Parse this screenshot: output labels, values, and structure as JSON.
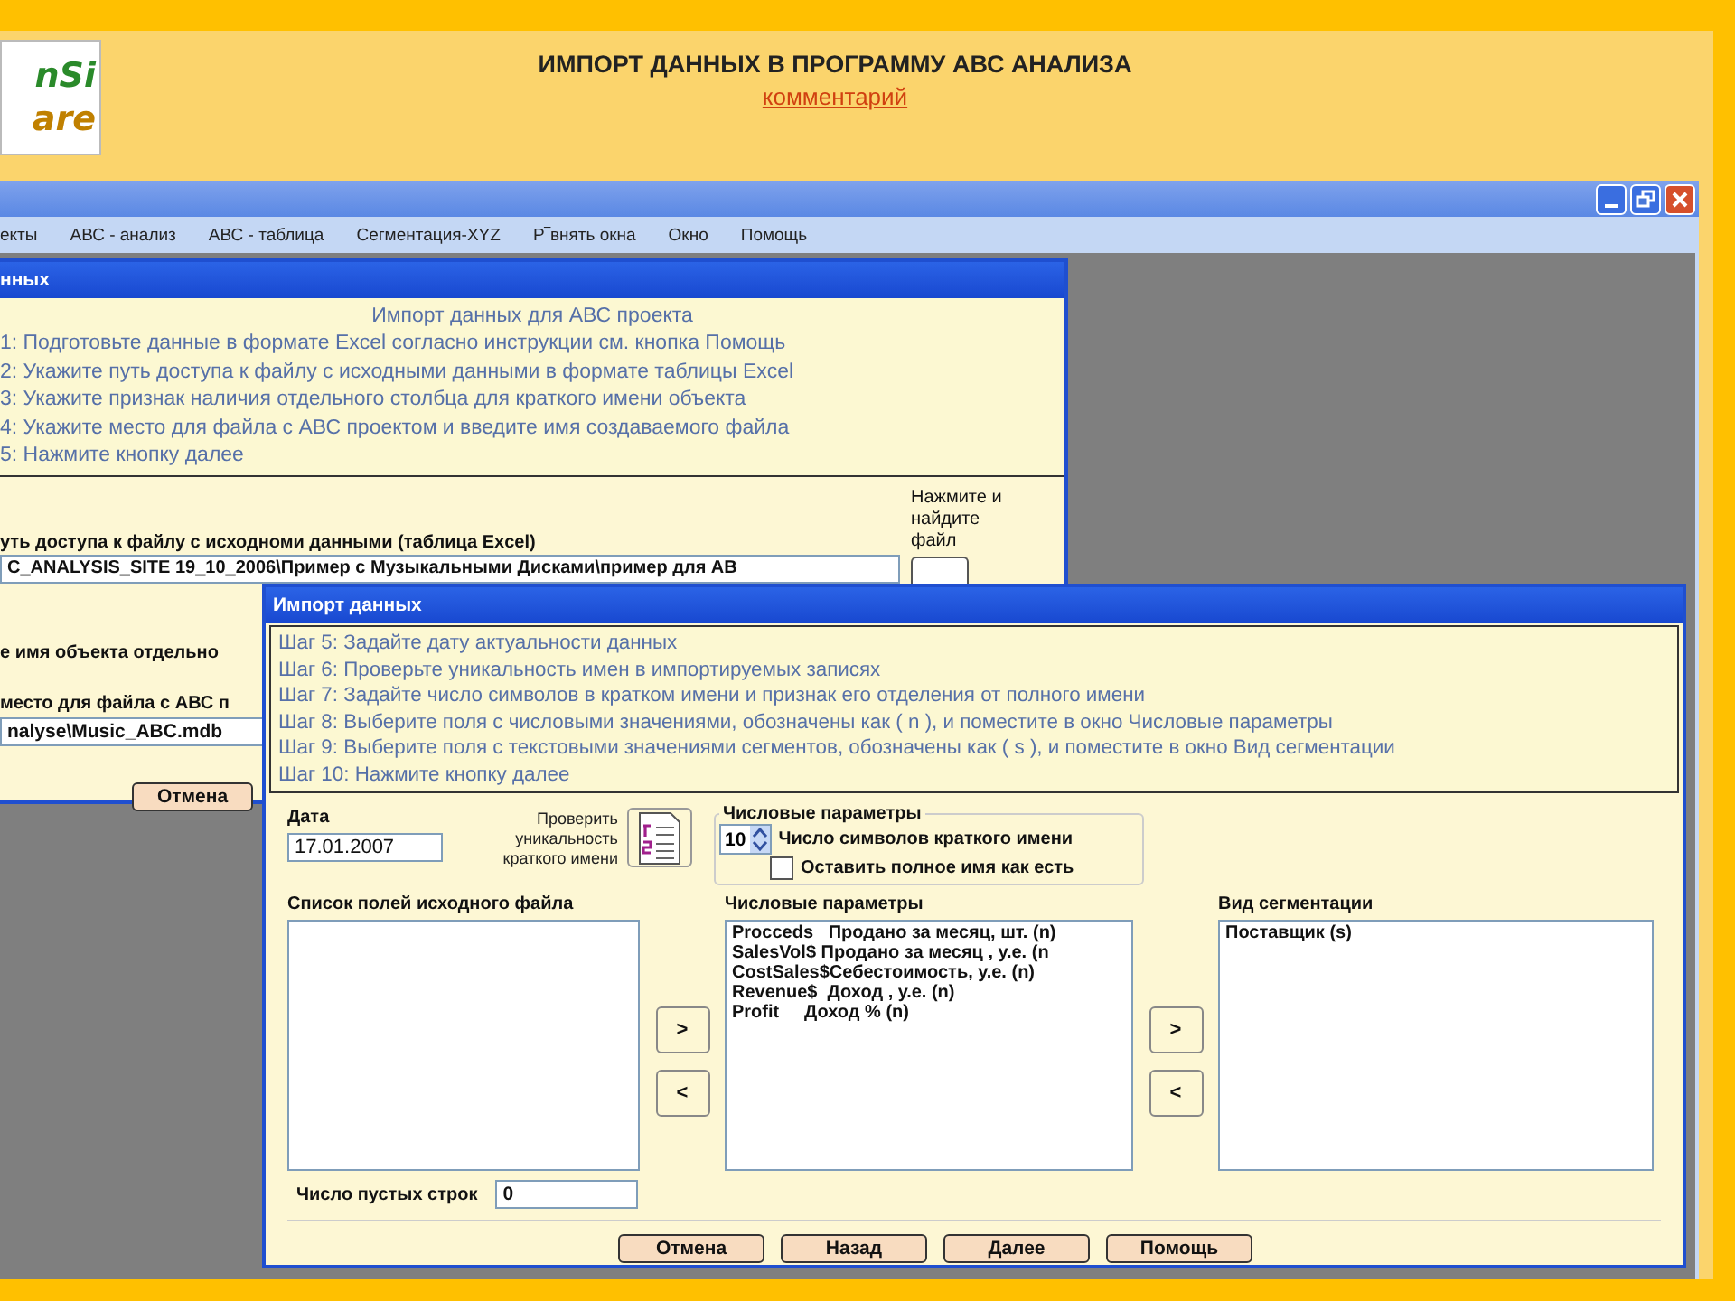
{
  "page": {
    "logo": [
      "nSi",
      "are"
    ],
    "heading": "ИМПОРТ ДАННЫХ В ПРОГРАММУ АВС АНАЛИЗА",
    "link": "комментарий"
  },
  "app_window": {
    "menu": [
      "екты",
      "АВС - анализ",
      "АВС - таблица",
      "Сегментация-XYZ",
      "Р‾внять окна",
      "Окно",
      "Помощь"
    ]
  },
  "dialog_back": {
    "title": "нных",
    "intro_title": "Импорт данных для АВС проекта",
    "steps": [
      "1: Подготовьте данные в формате Excel согласно инструкции см. кнопка Помощь",
      "2: Укажите путь доступа к файлу с исходными данными в формате таблицы Excel",
      "3: Укажите признак наличия отдельного столбца для краткого имени объекта",
      "4: Укажите место для файла с АВС проектом и введите имя создаваемого файла",
      "5: Нажмите кнопку далее"
    ],
    "browse_hint": "Нажмите и найдите файл",
    "path_label": "уть доступа к файлу с исходноми данными (таблица Excel)",
    "path_value": "C_ANALYSIS_SITE 19_10_2006\\Пример с Музыкальными Дисками\\пример для АВ",
    "short_name_label": "е имя объекта отдельно",
    "project_label": "место для файла с АВС п",
    "project_value": "nalyse\\Music_ABC.mdb",
    "cancel": "Отмена"
  },
  "dialog_front": {
    "title": "Импорт данных",
    "steps": [
      "Шаг 5: Задайте дату актуальности данных",
      "Шаг 6: Проверьте уникальность имен в импортируемых записях",
      "Шаг 7: Задайте число символов в кратком имени и признак его отделения от полного имени",
      "Шаг 8: Выберите поля с  числовыми значениями, обозначены как ( n ), и поместите в окно Числовые параметры",
      "Шаг 9: Выберите поля с  текстовыми значениями сегментов, обозначены как ( s ), и поместите в окно Вид сегментации",
      "Шаг 10: Нажмите кнопку далее"
    ],
    "date_label": "Дата",
    "date_value": "17.01.2007",
    "check_label": "Проверить уникальность краткого имени",
    "group": {
      "title": "Числовые параметры",
      "chars_value": "10",
      "chars_label": "Число символов краткого имени",
      "keep_full": {
        "label": "Оставить полное имя как есть",
        "checked": false
      }
    },
    "lists": [
      {
        "label": "Список полей исходного файла"
      },
      {
        "label": "Числовые параметры",
        "items": [
          "Procceds   Продано за месяц, шт. (n)",
          "SalesVol$ Продано за месяц , у.е. (n",
          "CostSales$Себестоимость, у.е. (n)",
          "Revenue$  Доход , у.е. (n)",
          "Profit     Доход % (n)"
        ]
      },
      {
        "label": "Вид сегментации",
        "items": [
          "Поставщик (s)"
        ]
      }
    ],
    "move_buttons": [
      [
        ">",
        "<"
      ],
      [
        ">",
        "<"
      ]
    ],
    "blank_rows": {
      "label": "Число пустых строк",
      "value": "0"
    },
    "buttons": [
      "Отмена",
      "Назад",
      "Далее",
      "Помощь"
    ]
  }
}
